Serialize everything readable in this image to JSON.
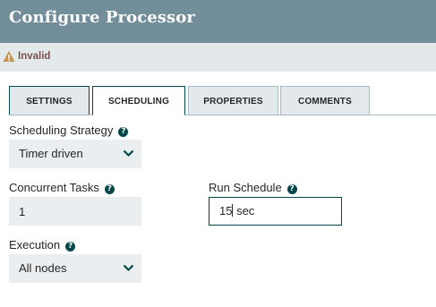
{
  "dialog": {
    "title": "Configure Processor",
    "status_label": "Invalid"
  },
  "tabs": [
    {
      "label": "SETTINGS"
    },
    {
      "label": "SCHEDULING"
    },
    {
      "label": "PROPERTIES"
    },
    {
      "label": "COMMENTS"
    }
  ],
  "active_tab": "SCHEDULING",
  "help_glyph": "?",
  "scheduling": {
    "strategy": {
      "label": "Scheduling Strategy",
      "value": "Timer driven"
    },
    "concurrent_tasks": {
      "label": "Concurrent Tasks",
      "value": "1"
    },
    "run_schedule": {
      "label": "Run Schedule",
      "value_before_caret": "15",
      "value_after_caret": " sec"
    },
    "execution": {
      "label": "Execution",
      "value": "All nodes"
    }
  },
  "colors": {
    "header": "#728e9b",
    "status_bar": "#e3e8eb",
    "warning": "#c3944d",
    "accent": "#004849",
    "field_bg": "#eaeef0"
  }
}
